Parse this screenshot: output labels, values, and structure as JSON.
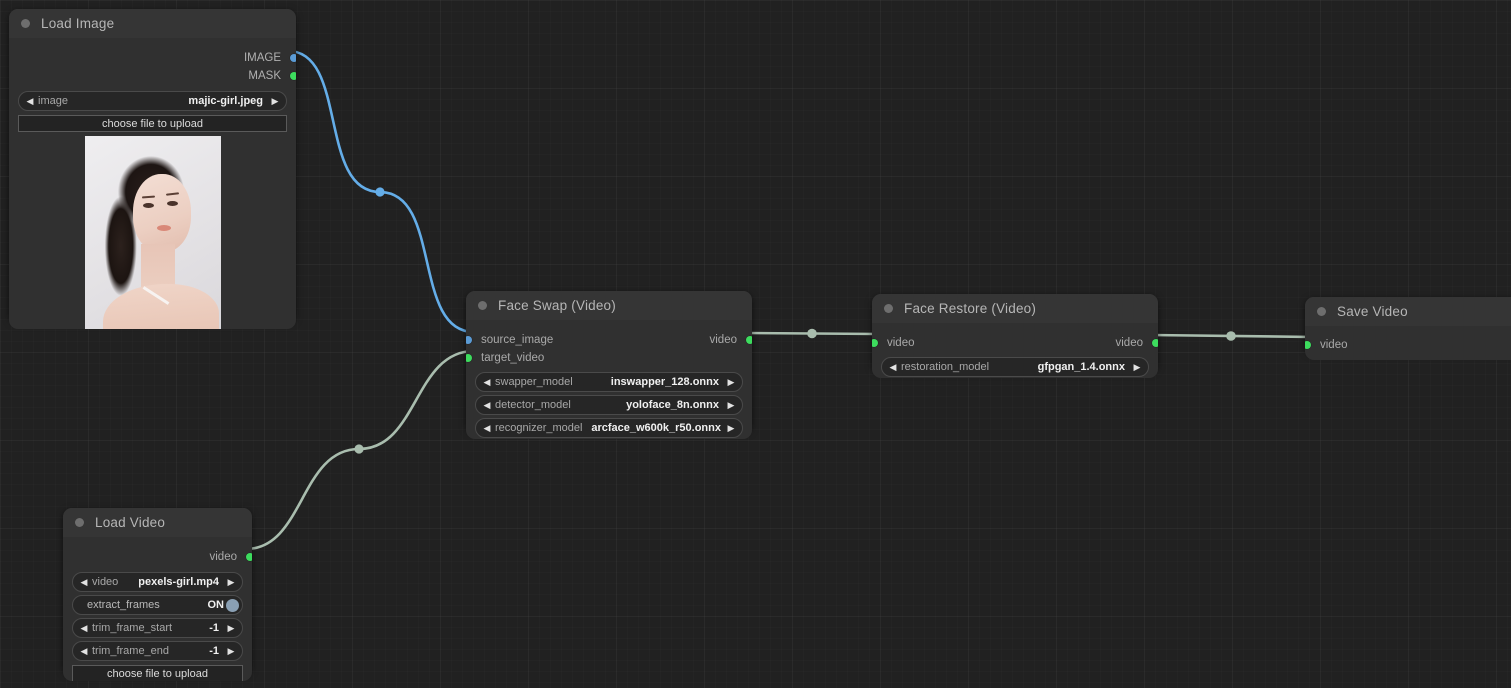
{
  "app": {
    "type": "node-graph-editor",
    "background_color": "#212121",
    "node_color": "#353535",
    "node_body_color": "#303030"
  },
  "link_colors": {
    "image": "#64ade8",
    "video": "#a9bdae"
  },
  "nodes": [
    {
      "id": "load-image",
      "title": "Load Image",
      "outputs": [
        {
          "label": "IMAGE",
          "color": "blue"
        },
        {
          "label": "MASK",
          "color": "green"
        }
      ],
      "widgets": [
        {
          "kind": "combo",
          "name": "image",
          "value": "majic-girl.jpeg"
        }
      ],
      "button": "choose file to upload",
      "has_preview": true
    },
    {
      "id": "face-swap-video",
      "title": "Face Swap (Video)",
      "inputs": [
        {
          "label": "source_image",
          "color": "blue"
        },
        {
          "label": "target_video",
          "color": "green"
        }
      ],
      "outputs": [
        {
          "label": "video",
          "color": "green"
        }
      ],
      "widgets": [
        {
          "kind": "combo",
          "name": "swapper_model",
          "value": "inswapper_128.onnx"
        },
        {
          "kind": "combo",
          "name": "detector_model",
          "value": "yoloface_8n.onnx"
        },
        {
          "kind": "combo",
          "name": "recognizer_model",
          "value": "arcface_w600k_r50.onnx"
        }
      ]
    },
    {
      "id": "face-restore-video",
      "title": "Face Restore (Video)",
      "inputs": [
        {
          "label": "video",
          "color": "green"
        }
      ],
      "outputs": [
        {
          "label": "video",
          "color": "green"
        }
      ],
      "widgets": [
        {
          "kind": "combo",
          "name": "restoration_model",
          "value": "gfpgan_1.4.onnx"
        }
      ]
    },
    {
      "id": "save-video",
      "title": "Save Video",
      "inputs": [
        {
          "label": "video",
          "color": "green"
        }
      ],
      "widgets": []
    },
    {
      "id": "load-video",
      "title": "Load Video",
      "outputs": [
        {
          "label": "video",
          "color": "green"
        }
      ],
      "widgets": [
        {
          "kind": "combo",
          "name": "video",
          "value": "pexels-girl.mp4"
        },
        {
          "kind": "toggle",
          "name": "extract_frames",
          "value": "ON"
        },
        {
          "kind": "number",
          "name": "trim_frame_start",
          "value": "-1"
        },
        {
          "kind": "number",
          "name": "trim_frame_end",
          "value": "-1"
        }
      ],
      "button": "choose file to upload"
    }
  ],
  "icons": {
    "arrow_left": "◀",
    "arrow_right": "▶"
  }
}
